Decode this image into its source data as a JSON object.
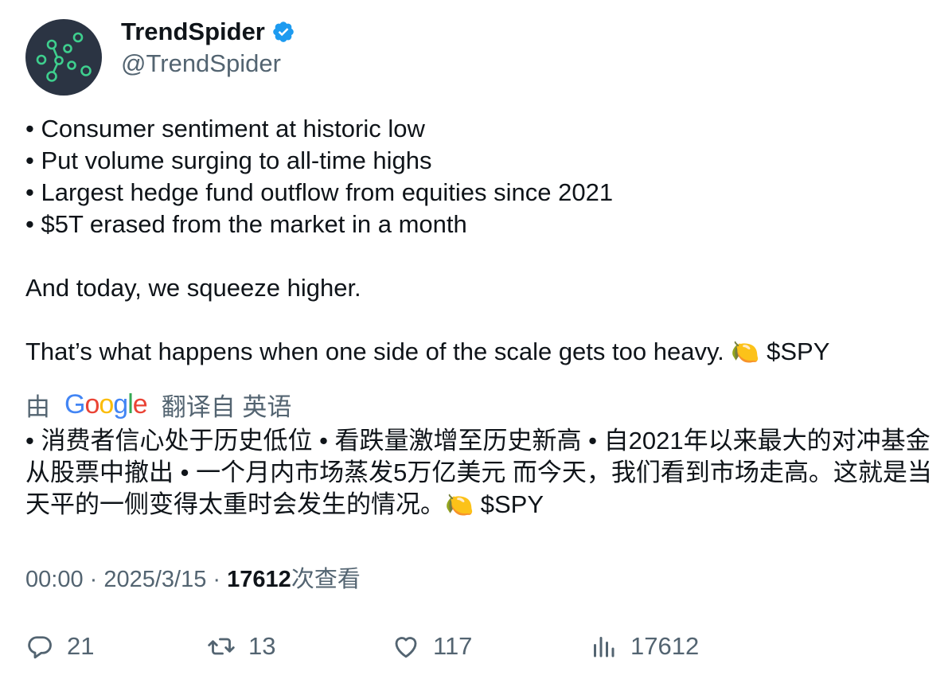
{
  "author": {
    "name": "TrendSpider",
    "handle": "@TrendSpider",
    "verified": true,
    "avatar_icon": "trendspider-logo-icon",
    "avatar_bg": "#2b3443",
    "avatar_accent": "#3ecf8e"
  },
  "tweet": {
    "lines": [
      "• Consumer sentiment at historic low",
      "• Put volume surging to all-time highs",
      "• Largest hedge fund outflow from equities since 2021",
      "• $5T erased from the market in a month"
    ],
    "para2": "And today, we squeeze higher.",
    "para3_prefix": "That’s what happens when one side of the scale gets too heavy. ",
    "emoji": "🍋",
    "cashtag": "$SPY"
  },
  "translation": {
    "by_label": "由",
    "google_label": "Google",
    "from_label": "翻译自 英语",
    "text_prefix": "• 消费者信心处于历史低位 • 看跌量激增至历史新高 • 自2021年以来最大的对冲基金从股票中撤出 • 一个月内市场蒸发5万亿美元 而今天，我们看到市场走高。这就是当天平的一侧变得太重时会发生的情况。",
    "emoji": "🍋",
    "cashtag": "$SPY"
  },
  "meta": {
    "time": "00:00",
    "separator": " · ",
    "date": "2025/3/15",
    "views": "17612",
    "views_label": "次查看"
  },
  "actions": {
    "replies": "21",
    "retweets": "13",
    "likes": "117",
    "views": "17612"
  },
  "colors": {
    "text": "#0f1419",
    "secondary": "#536471",
    "verified": "#1d9bf0"
  }
}
